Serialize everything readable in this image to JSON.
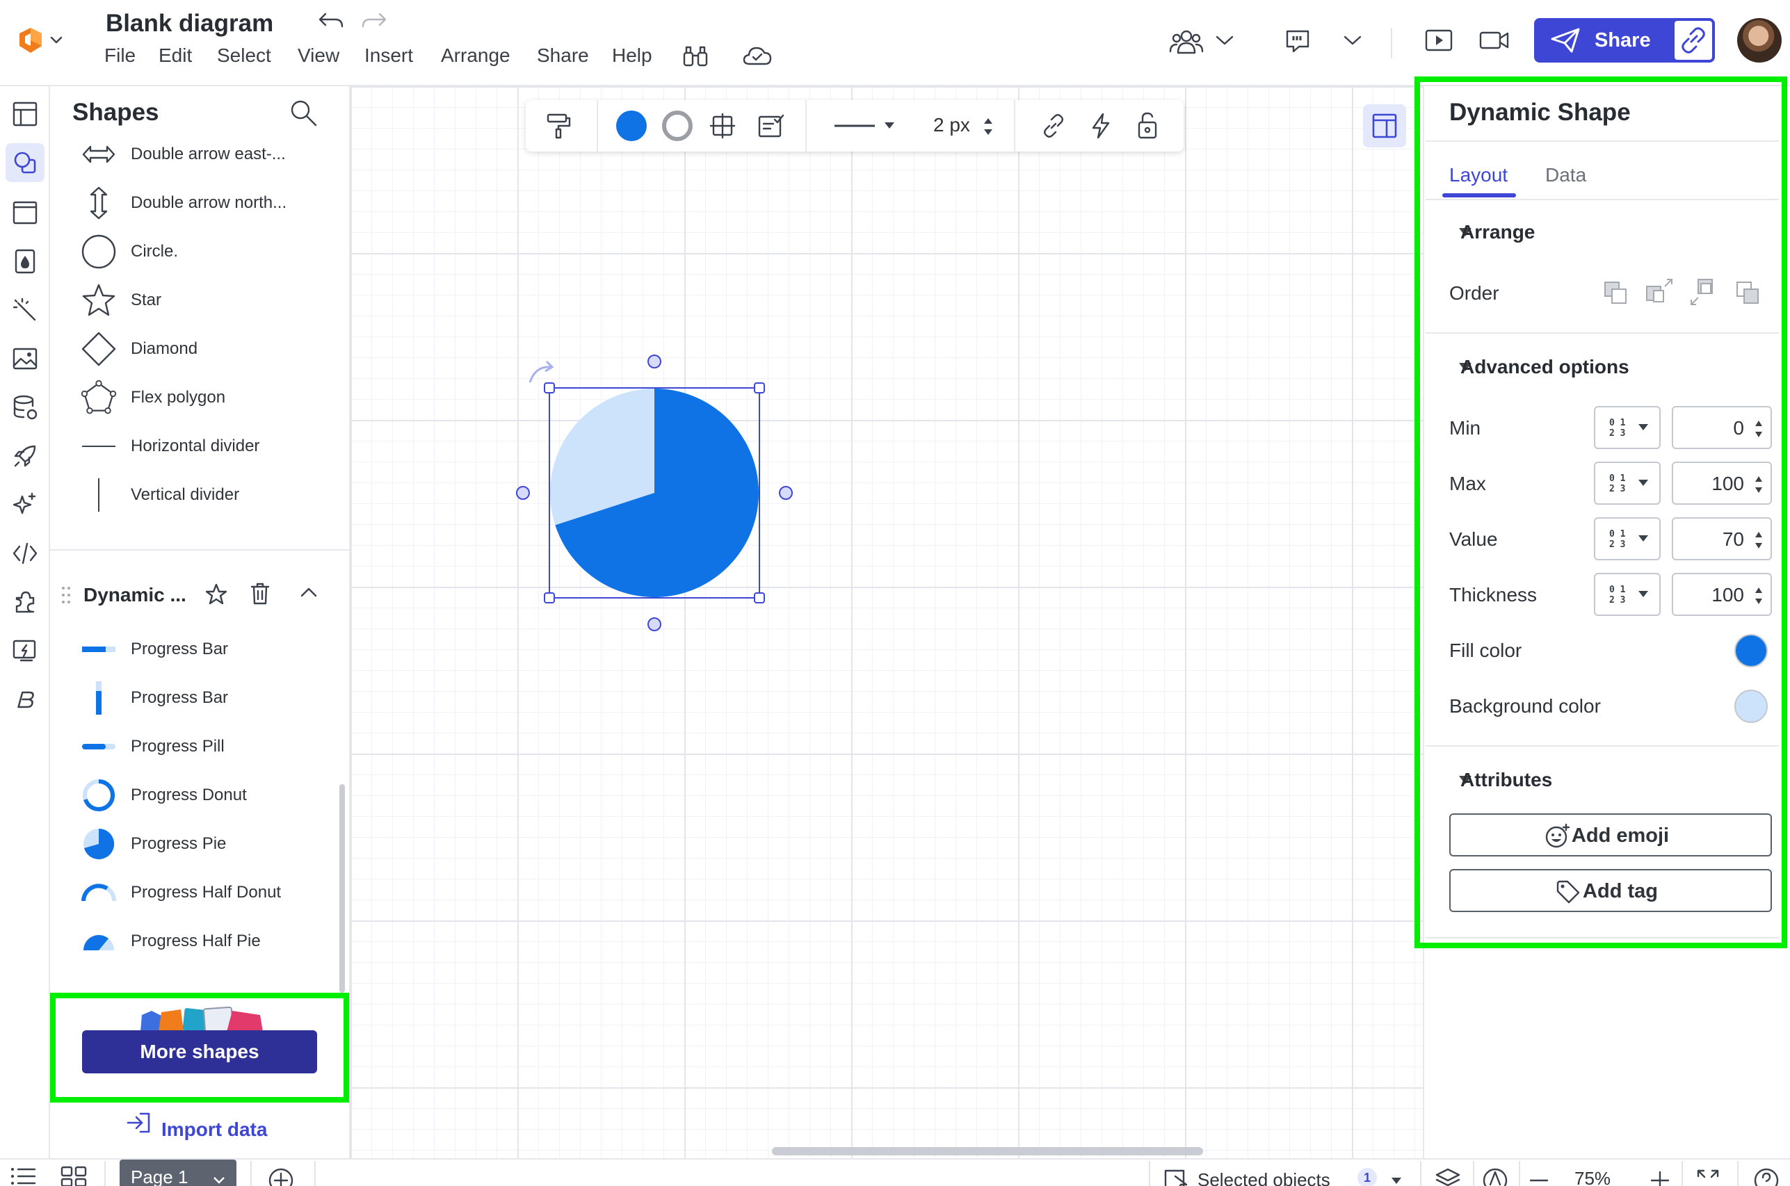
{
  "header": {
    "title": "Blank diagram",
    "menu": [
      "File",
      "Edit",
      "Select",
      "View",
      "Insert",
      "Arrange",
      "Share",
      "Help"
    ],
    "share_label": "Share"
  },
  "shapes_panel": {
    "title": "Shapes",
    "items": [
      {
        "label": "Double arrow east-...",
        "icon": "double-arrow-horizontal-icon"
      },
      {
        "label": "Double arrow north...",
        "icon": "double-arrow-vertical-icon"
      },
      {
        "label": "Circle.",
        "icon": "circle-shape-icon"
      },
      {
        "label": "Star",
        "icon": "star-shape-icon"
      },
      {
        "label": "Diamond",
        "icon": "diamond-shape-icon"
      },
      {
        "label": "Flex polygon",
        "icon": "flex-polygon-icon"
      },
      {
        "label": "Horizontal divider",
        "icon": "horizontal-divider-icon"
      },
      {
        "label": "Vertical divider",
        "icon": "vertical-divider-icon"
      }
    ],
    "library_title": "Dynamic ...",
    "dynamic_items": [
      {
        "label": "Progress Bar",
        "icon": "progress-bar-horizontal-icon"
      },
      {
        "label": "Progress Bar",
        "icon": "progress-bar-vertical-icon"
      },
      {
        "label": "Progress Pill",
        "icon": "progress-pill-icon"
      },
      {
        "label": "Progress Donut",
        "icon": "progress-donut-icon"
      },
      {
        "label": "Progress Pie",
        "icon": "progress-pie-icon"
      },
      {
        "label": "Progress Half Donut",
        "icon": "progress-half-donut-icon"
      },
      {
        "label": "Progress Half Pie",
        "icon": "progress-half-pie-icon"
      }
    ],
    "more_shapes_label": "More shapes",
    "import_label": "Import data"
  },
  "toolbar": {
    "fill_color": "#0f73e6",
    "stroke_color": "#9b9fa5",
    "stroke_width": "2 px"
  },
  "canvas": {
    "shape": {
      "type": "progress-pie",
      "value": 70,
      "min": 0,
      "max": 100,
      "fill": "#0f73e6",
      "background": "#cde2fb"
    }
  },
  "right_panel": {
    "title": "Dynamic Shape",
    "tabs": [
      "Layout",
      "Data"
    ],
    "active_tab": "Layout",
    "arrange": {
      "header": "Arrange",
      "order_label": "Order"
    },
    "advanced": {
      "header": "Advanced options",
      "fields": [
        {
          "label": "Min",
          "value": "0"
        },
        {
          "label": "Max",
          "value": "100"
        },
        {
          "label": "Value",
          "value": "70"
        },
        {
          "label": "Thickness",
          "value": "100"
        }
      ],
      "fill_label": "Fill color",
      "fill_color": "#0f73e6",
      "bg_label": "Background color",
      "bg_color": "#cde2fb"
    },
    "attributes": {
      "header": "Attributes",
      "emoji_label": "Add emoji",
      "tag_label": "Add tag"
    }
  },
  "footer": {
    "page_label": "Page 1",
    "selected_label": "Selected objects",
    "selected_count": "1",
    "zoom": "75%"
  }
}
